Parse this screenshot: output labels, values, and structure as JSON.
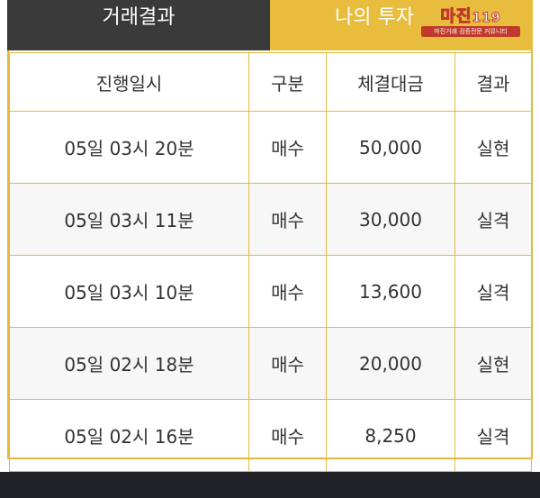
{
  "tabs": {
    "trade_results": "거래결과",
    "my_investment": "나의 투자"
  },
  "logo": {
    "title": "마진",
    "suffix": "119",
    "subtitle": "마진거래 검증전문 커뮤니티"
  },
  "table": {
    "headers": {
      "time": "진행일시",
      "type": "구분",
      "amount": "체결대금",
      "result": "결과"
    },
    "rows": [
      {
        "time": "05일 03시 20분",
        "type": "매수",
        "amount": "50,000",
        "result": "실현"
      },
      {
        "time": "05일 03시 11분",
        "type": "매수",
        "amount": "30,000",
        "result": "실격"
      },
      {
        "time": "05일 03시 10분",
        "type": "매수",
        "amount": "13,600",
        "result": "실격"
      },
      {
        "time": "05일 02시 18분",
        "type": "매수",
        "amount": "20,000",
        "result": "실현"
      },
      {
        "time": "05일 02시 16분",
        "type": "매수",
        "amount": "8,250",
        "result": "실격"
      }
    ]
  },
  "colors": {
    "accent_gold": "#e8bd3e",
    "tab_dark": "#3a3a3a",
    "buy_red": "#c62828",
    "realized_red": "#c62828",
    "disqualified_blue": "#2b9bc8",
    "bottom_bar": "#1f2126"
  }
}
